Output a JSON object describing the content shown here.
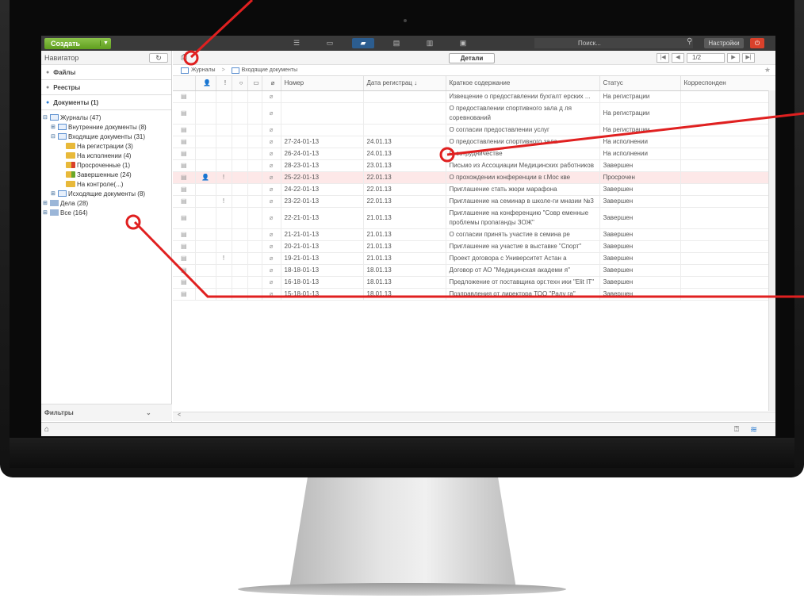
{
  "topbar": {
    "create_label": "Создать",
    "search_placeholder": "Поиск...",
    "settings_label": "Настройки",
    "accent_color": "#6aa82a"
  },
  "sidebar": {
    "title": "Навигатор",
    "sections": [
      "Файлы",
      "Реестры",
      "Документы (1)"
    ],
    "tree": [
      {
        "label": "Журналы (47)",
        "level": 0,
        "icon": "journal-icon",
        "toggle": "⊟"
      },
      {
        "label": "Внутренние документы (8)",
        "level": 1,
        "icon": "journal-icon",
        "toggle": "⊞"
      },
      {
        "label": "Входящие документы (31)",
        "level": 1,
        "icon": "journal-icon",
        "toggle": "⊟"
      },
      {
        "label": "На регистрации (3)",
        "level": 2,
        "icon": "folder-icon",
        "toggle": ""
      },
      {
        "label": "На исполнении (4)",
        "level": 2,
        "icon": "folder-icon",
        "toggle": ""
      },
      {
        "label": "Просроченные (1)",
        "level": 2,
        "icon": "folder-red-icon",
        "toggle": ""
      },
      {
        "label": "Завершенные (24)",
        "level": 2,
        "icon": "folder-green-icon",
        "toggle": ""
      },
      {
        "label": "На контроле(...)",
        "level": 2,
        "icon": "folder-icon",
        "toggle": ""
      },
      {
        "label": "Исходящие документы (8)",
        "level": 1,
        "icon": "journal-icon",
        "toggle": "⊞"
      },
      {
        "label": "Дела (28)",
        "level": 0,
        "icon": "cases-icon",
        "toggle": "⊞"
      },
      {
        "label": "Все (164)",
        "level": 0,
        "icon": "all-icon",
        "toggle": "⊞"
      }
    ],
    "filters_label": "Фильтры"
  },
  "main": {
    "details_label": "Детали",
    "pager_value": "1/2",
    "breadcrumb": [
      "Журналы",
      "Входящие документы"
    ],
    "columns": [
      "Номер",
      "Дата регистрац",
      "Краткое содержание",
      "Статус",
      "Корреспонден"
    ],
    "rows": [
      {
        "num": "",
        "date": "",
        "summary": "Извещение о предоставлении бухгалт ерских ...",
        "status": "На регистрации",
        "cls": "st-reg",
        "user": "",
        "flag": "",
        "over": false
      },
      {
        "num": "",
        "date": "",
        "summary": "О предоставлении спортивного зала д ля соревнований",
        "status": "На регистрации",
        "cls": "st-reg",
        "user": "",
        "flag": "",
        "over": false
      },
      {
        "num": "",
        "date": "",
        "summary": "О согласии предоставлении услуг",
        "status": "На регистрации",
        "cls": "st-reg",
        "user": "",
        "flag": "",
        "over": false
      },
      {
        "num": "27-24-01-13",
        "date": "24.01.13",
        "summary": "О предоставлении спортивного зала",
        "status": "На исполнении",
        "cls": "st-exec",
        "user": "",
        "flag": "",
        "over": false
      },
      {
        "num": "26-24-01-13",
        "date": "24.01.13",
        "summary": "О сотрудничестве",
        "status": "На исполнении",
        "cls": "st-exec",
        "user": "",
        "flag": "",
        "over": false
      },
      {
        "num": "28-23-01-13",
        "date": "23.01.13",
        "summary": "Письмо из Ассоциации Медицинских работников",
        "status": "Завершен",
        "cls": "st-done",
        "user": "",
        "flag": "",
        "over": false
      },
      {
        "num": "25-22-01-13",
        "date": "22.01.13",
        "summary": "О прохождении конференции в г.Мос кве",
        "status": "Просрочен",
        "cls": "st-late",
        "user": "👤",
        "flag": "!",
        "over": true
      },
      {
        "num": "24-22-01-13",
        "date": "22.01.13",
        "summary": "Приглашение стать жюри марафона",
        "status": "Завершен",
        "cls": "st-done",
        "user": "",
        "flag": "",
        "over": false
      },
      {
        "num": "23-22-01-13",
        "date": "22.01.13",
        "summary": "Приглашение на семинар в школе-ги мназии №3",
        "status": "Завершен",
        "cls": "st-done",
        "user": "",
        "flag": "!",
        "over": false
      },
      {
        "num": "22-21-01-13",
        "date": "21.01.13",
        "summary": "Приглашение на конференцию \"Совр еменные проблемы пропаганды ЗОЖ\"",
        "status": "Завершен",
        "cls": "st-done",
        "user": "",
        "flag": "",
        "over": false
      },
      {
        "num": "21-21-01-13",
        "date": "21.01.13",
        "summary": "О согласии принять участие в семина ре",
        "status": "Завершен",
        "cls": "st-done",
        "user": "",
        "flag": "",
        "over": false
      },
      {
        "num": "20-21-01-13",
        "date": "21.01.13",
        "summary": "Приглашение на участие в выставке \"Спорт\"",
        "status": "Завершен",
        "cls": "st-done",
        "user": "",
        "flag": "",
        "over": false
      },
      {
        "num": "19-21-01-13",
        "date": "21.01.13",
        "summary": "Проект договора с Университет Астан а",
        "status": "Завершен",
        "cls": "st-done",
        "user": "",
        "flag": "!",
        "over": false
      },
      {
        "num": "18-18-01-13",
        "date": "18.01.13",
        "summary": "Договор от АО \"Медицинская академи я\"",
        "status": "Завершен",
        "cls": "st-done",
        "user": "",
        "flag": "",
        "over": false
      },
      {
        "num": "16-18-01-13",
        "date": "18.01.13",
        "summary": "Предложение от поставщика орг.техн ики \"Elit IT\"",
        "status": "Завершен",
        "cls": "st-done",
        "user": "",
        "flag": "",
        "over": false
      },
      {
        "num": "15-18-01-13",
        "date": "18.01.13",
        "summary": "Поздравления от директора ТОО \"Раду га\"",
        "status": "Завершен",
        "cls": "st-done",
        "user": "",
        "flag": "",
        "over": false
      }
    ]
  },
  "colors": {
    "callout": "#e02020",
    "status_registration": "#2c7cd1",
    "status_done": "#3a9a20",
    "status_overdue": "#d9302b"
  }
}
